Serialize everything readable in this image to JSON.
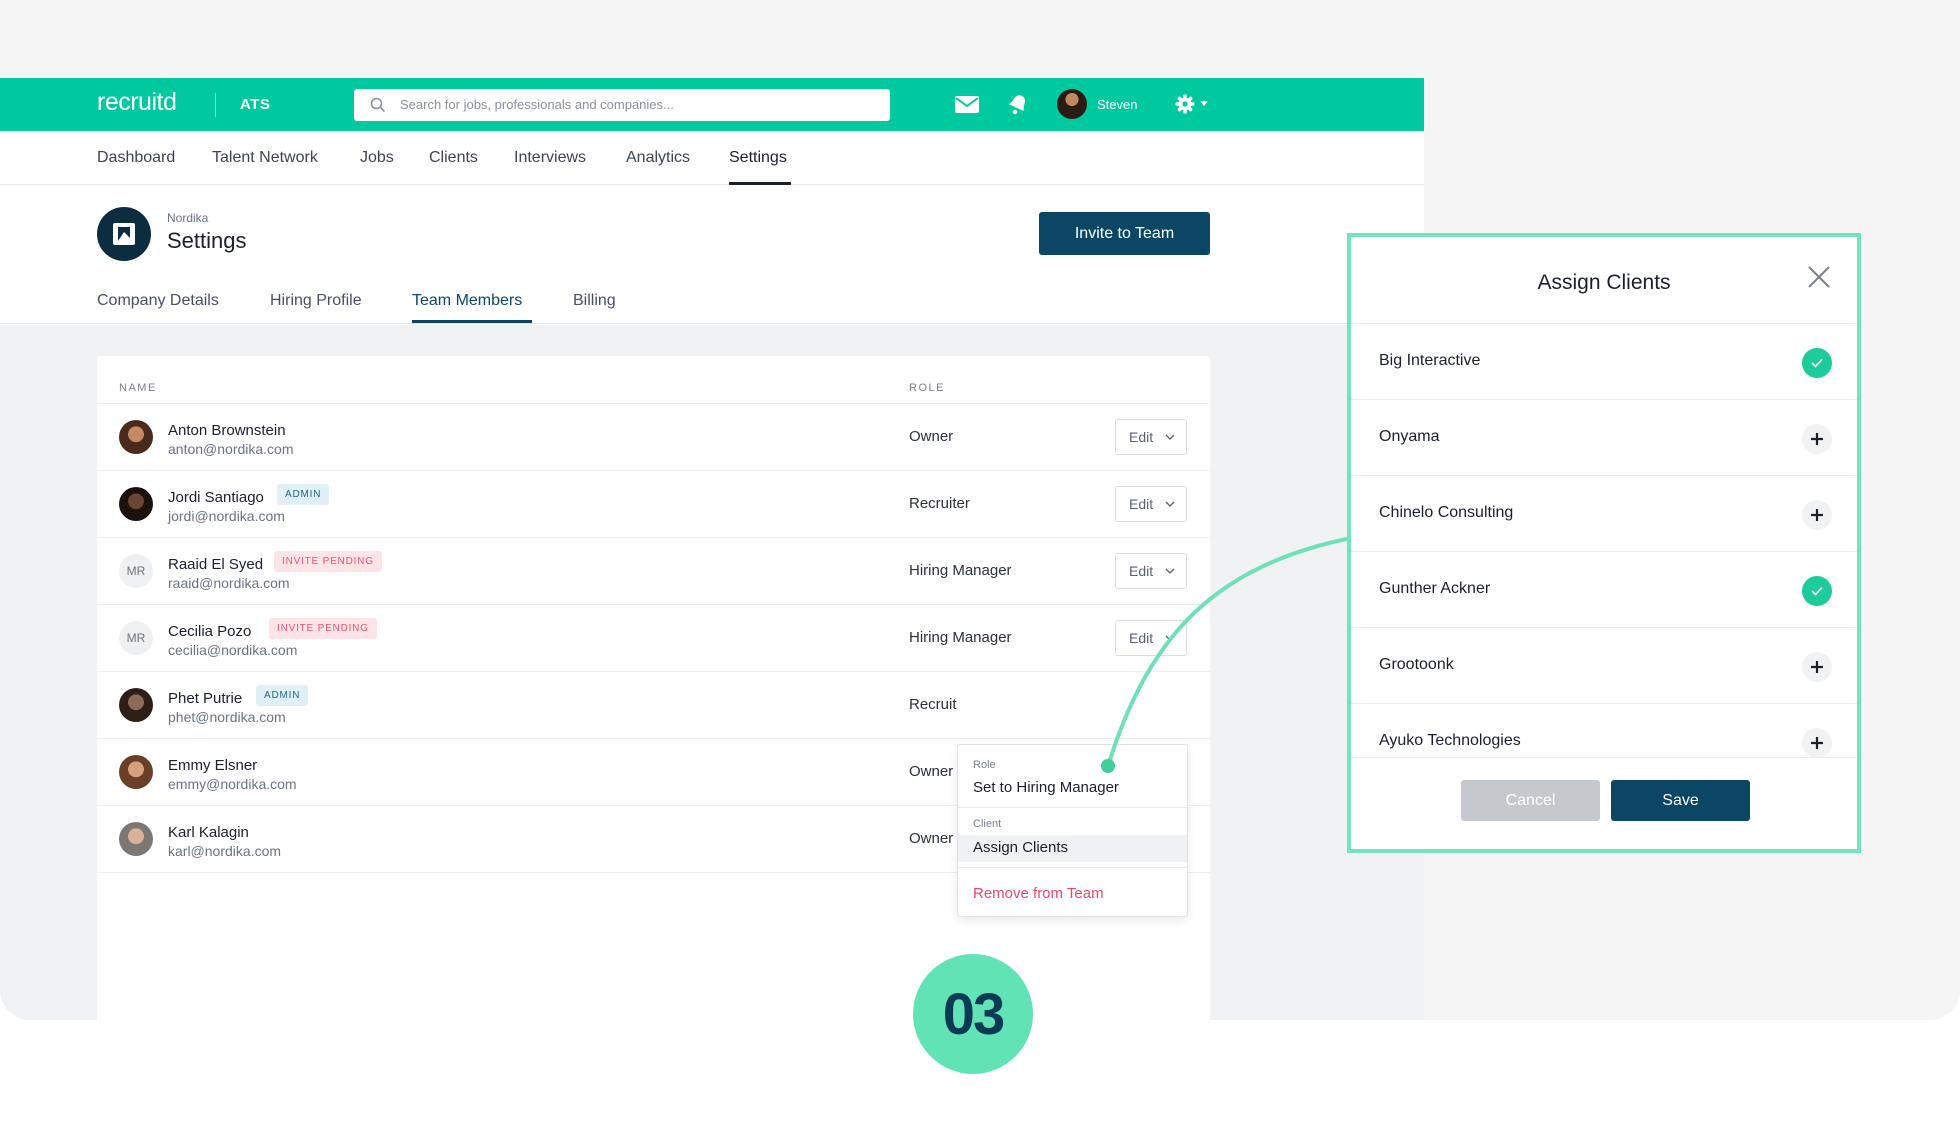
{
  "app": {
    "logo": "recruitd",
    "product": "ATS"
  },
  "header": {
    "search_placeholder": "Search for jobs, professionals and companies...",
    "user_name": "Steven"
  },
  "nav": [
    "Dashboard",
    "Talent Network",
    "Jobs",
    "Clients",
    "Interviews",
    "Analytics",
    "Settings"
  ],
  "page": {
    "org": "Nordika",
    "title": "Settings",
    "invite_label": "Invite to Team",
    "tabs": [
      "Company Details",
      "Hiring Profile",
      "Team Members",
      "Billing"
    ]
  },
  "table": {
    "headers": {
      "name": "NAME",
      "role": "ROLE"
    },
    "edit_label": "Edit",
    "rows": [
      {
        "name": "Anton Brownstein",
        "email": "anton@nordika.com",
        "role": "Owner",
        "badge": ""
      },
      {
        "name": "Jordi Santiago",
        "email": "jordi@nordika.com",
        "role": "Recruiter",
        "badge": "ADMIN"
      },
      {
        "name": "Raaid El Syed",
        "email": "raaid@nordika.com",
        "role": "Hiring Manager",
        "badge": "INVITE PENDING",
        "initials": "MR"
      },
      {
        "name": "Cecilia Pozo",
        "email": "cecilia@nordika.com",
        "role": "Hiring Manager",
        "badge": "INVITE PENDING",
        "initials": "MR"
      },
      {
        "name": "Phet Putrie",
        "email": "phet@nordika.com",
        "role": "Recruit",
        "badge": "ADMIN"
      },
      {
        "name": "Emmy Elsner",
        "email": "emmy@nordika.com",
        "role": "Owner",
        "badge": ""
      },
      {
        "name": "Karl Kalagin",
        "email": "karl@nordika.com",
        "role": "Owner",
        "badge": ""
      }
    ]
  },
  "dropdown": {
    "role_label": "Role",
    "role_action": "Set to Hiring Manager",
    "client_label": "Client",
    "client_action": "Assign Clients",
    "remove": "Remove from Team"
  },
  "modal": {
    "title": "Assign Clients",
    "clients": [
      {
        "name": "Big Interactive",
        "assigned": true
      },
      {
        "name": "Onyama",
        "assigned": false
      },
      {
        "name": "Chinelo Consulting",
        "assigned": false
      },
      {
        "name": "Gunther Ackner",
        "assigned": true
      },
      {
        "name": "Grootoonk",
        "assigned": false
      },
      {
        "name": "Ayuko Technologies",
        "assigned": false
      }
    ],
    "cancel": "Cancel",
    "save": "Save"
  },
  "step": "03",
  "colors": {
    "brand": "#00c9a0",
    "primary": "#0b4764",
    "danger": "#e8486a",
    "highlight": "#74e3bf"
  }
}
